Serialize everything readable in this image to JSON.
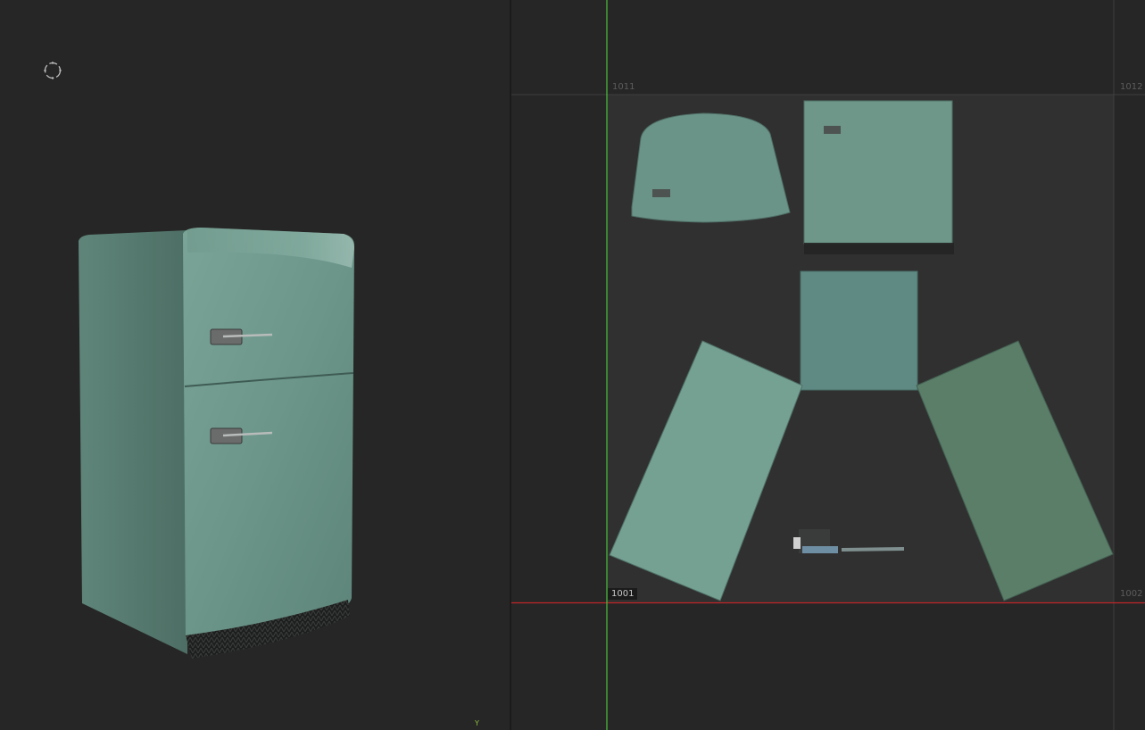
{
  "viewport_3d": {
    "axis_y_label": "Y",
    "gizmo_icon": "rotate-gizmo-icon",
    "model_color": "#6f9b8e"
  },
  "uv_editor": {
    "tiles": {
      "tile_1011": "1011",
      "tile_1012": "1012",
      "tile_1001": "1001",
      "tile_1002": "1002"
    },
    "axis_colors": {
      "u_axis": "#c0262b",
      "v_axis": "#49c43a"
    },
    "active_tile_color": "#303030"
  }
}
